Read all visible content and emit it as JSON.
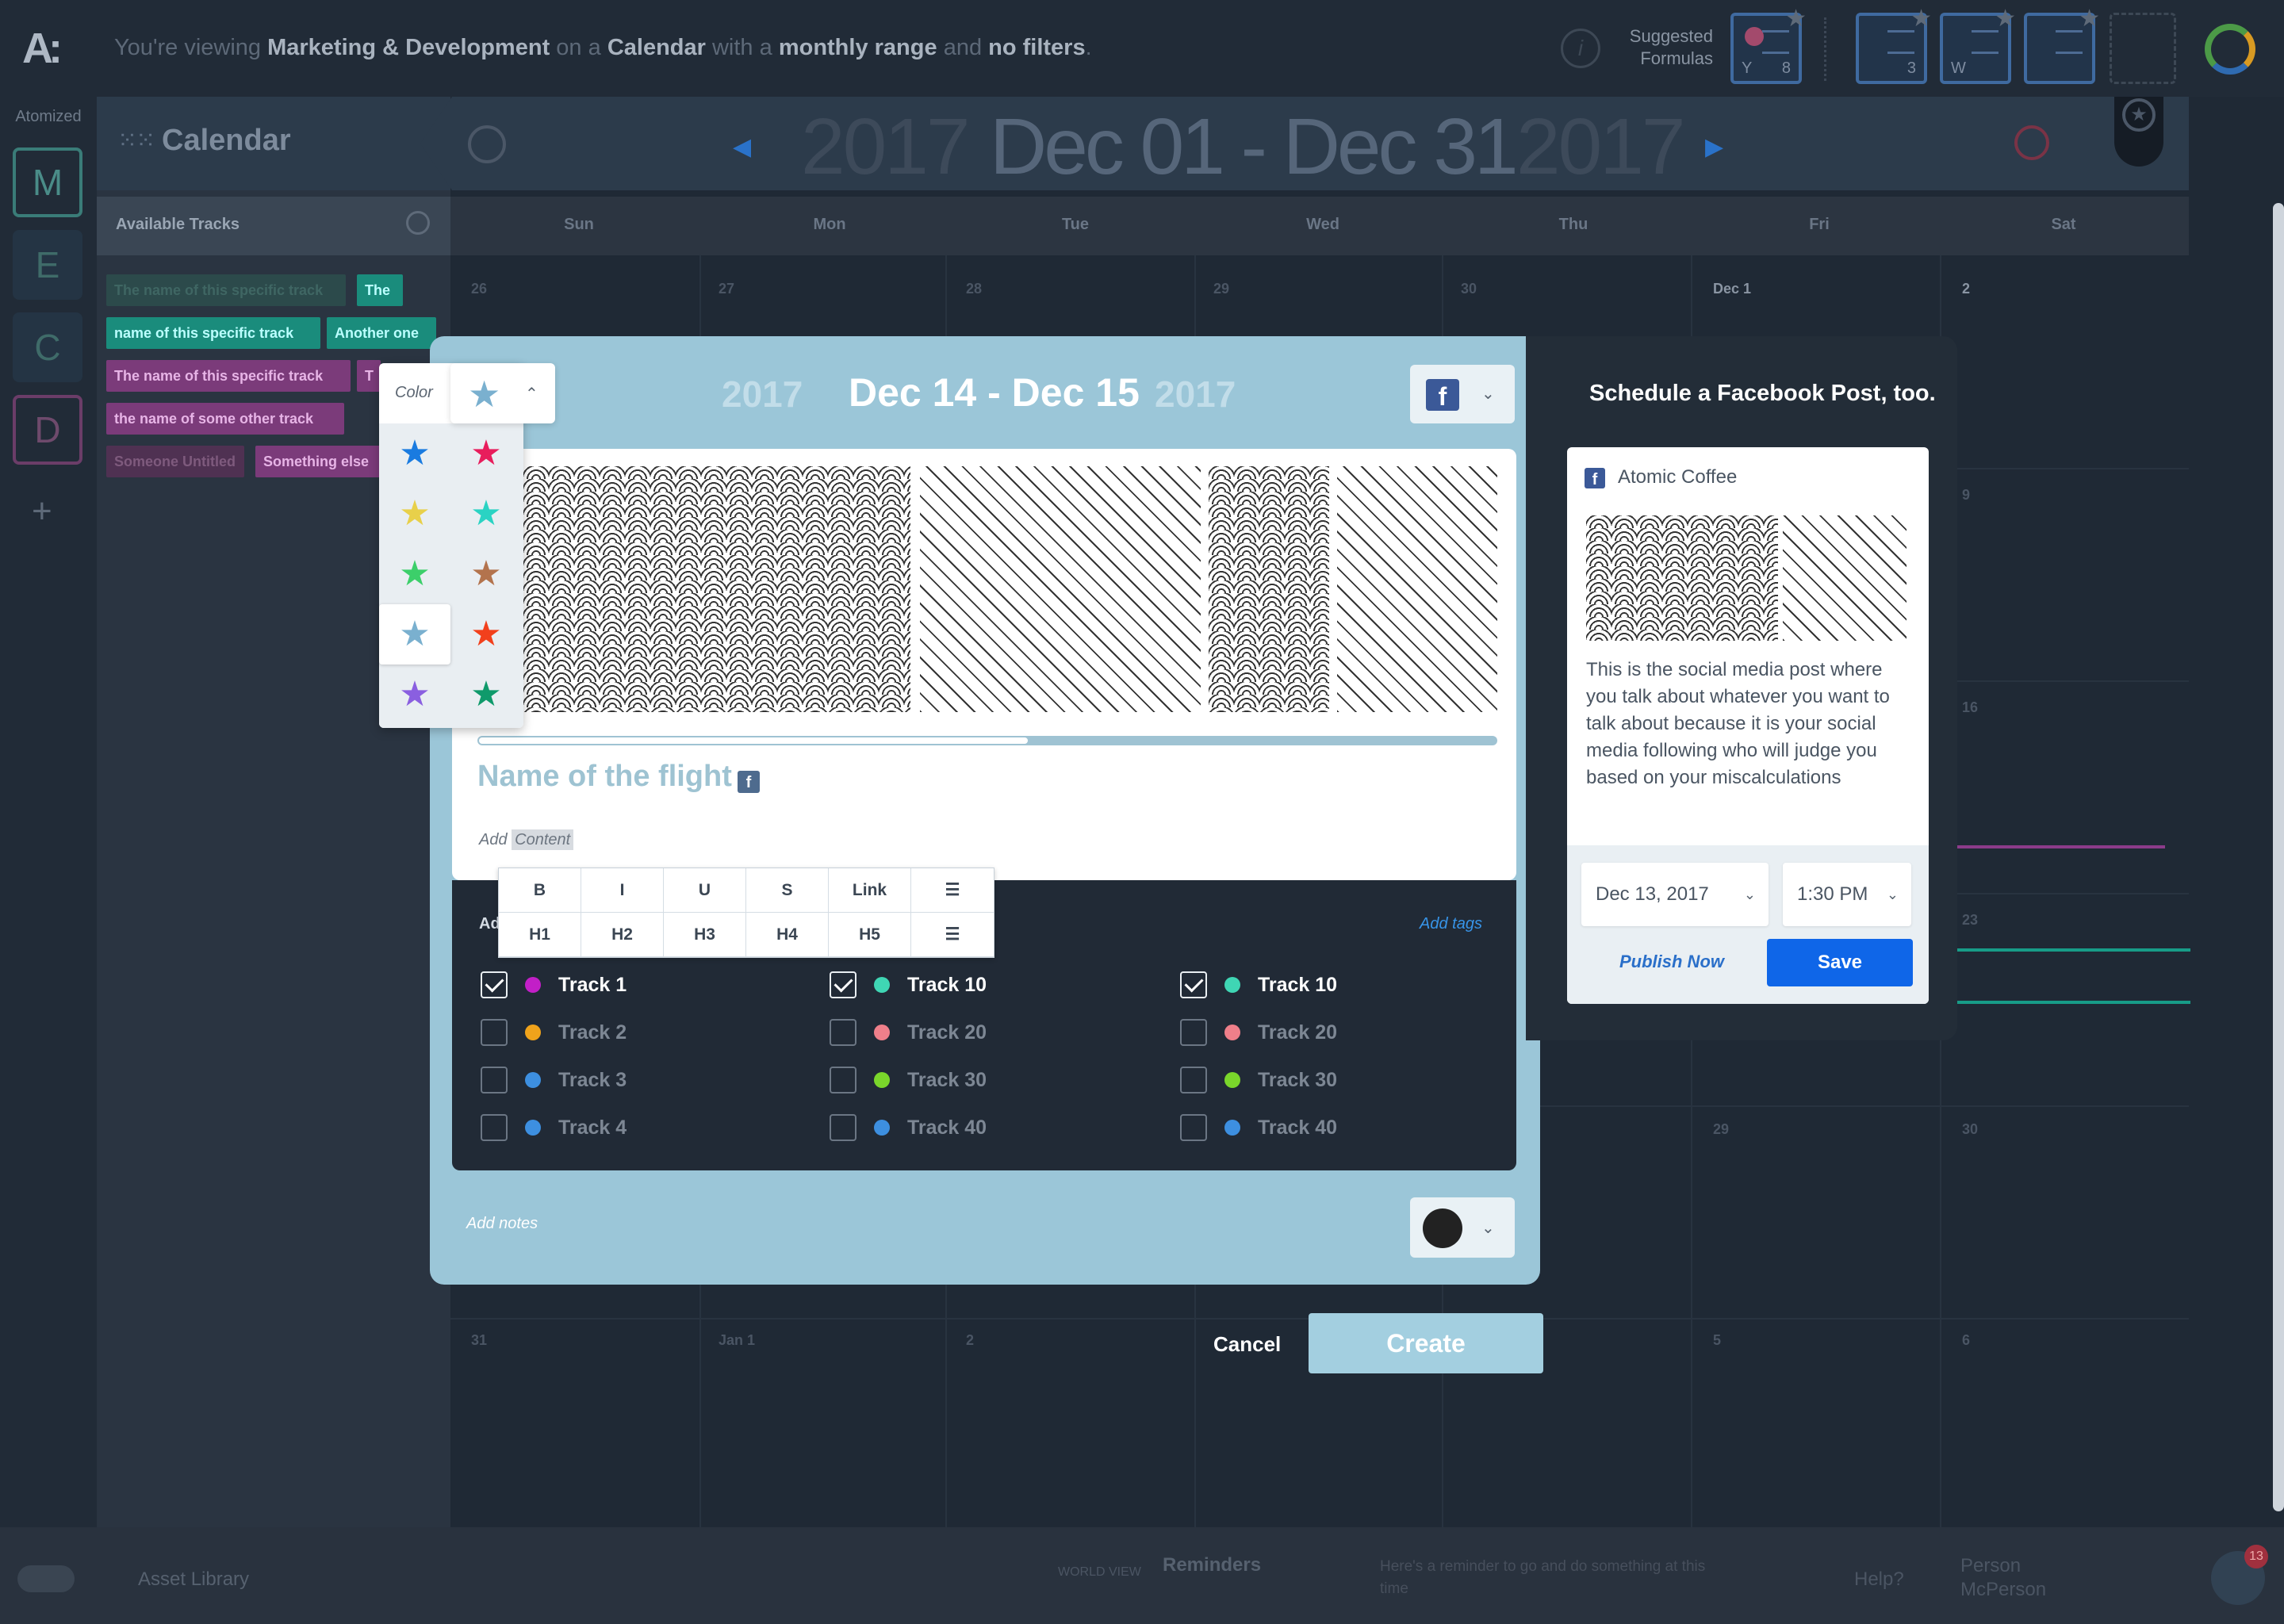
{
  "header": {
    "prefix": "You're viewing",
    "team": "Marketing & Development",
    "on_a": "on a",
    "view": "Calendar",
    "with_a": "with a",
    "range": "monthly range",
    "and": "and",
    "filters": "no filters",
    "suffix": ".",
    "suggested": "Suggested Formulas",
    "formula_cards": [
      {
        "letter": "Y",
        "num": "8"
      },
      {
        "letter": "",
        "num": "3"
      },
      {
        "letter": "W",
        "num": ""
      },
      {
        "letter": "",
        "num": ""
      }
    ]
  },
  "rail": {
    "label": "Atomized",
    "tiles": [
      "M",
      "E",
      "C",
      "D"
    ],
    "add": "+"
  },
  "sidebar": {
    "title": "Calendar",
    "tracks_title": "Available Tracks",
    "chips": [
      "The name of this specific track",
      "The",
      "name of this specific track",
      "Another one",
      "The name of this specific track",
      "T",
      "the name of some other track",
      "Someone Untitled",
      "Something else"
    ]
  },
  "calendar": {
    "year_left": "2017",
    "range": "Dec 01 - Dec 31",
    "year_right": "2017",
    "days": [
      "Sun",
      "Mon",
      "Tue",
      "Wed",
      "Thu",
      "Fri",
      "Sat"
    ],
    "dates_row1": [
      "26",
      "27",
      "28",
      "29",
      "30",
      "Dec 1",
      "2"
    ],
    "side_dates": [
      "9",
      "16",
      "23"
    ],
    "row5": [
      "29",
      "30"
    ],
    "row6": [
      "31",
      "Jan 1",
      "2",
      "5",
      "6"
    ]
  },
  "modal": {
    "year_left": "2017",
    "range": "Dec 14 - Dec 15",
    "year_right": "2017",
    "flight_name": "Name of the flight",
    "add": "Add",
    "content": "Content",
    "format_buttons": [
      "B",
      "I",
      "U",
      "S",
      "Link",
      "",
      "H1",
      "H2",
      "H3",
      "H4",
      "H5",
      ""
    ],
    "ad_label": "Ad",
    "add_tags": "Add tags",
    "tracks_col1": [
      {
        "name": "Track 1",
        "checked": true,
        "color": "#c21fc7"
      },
      {
        "name": "Track 2",
        "checked": false,
        "color": "#f0a31b"
      },
      {
        "name": "Track 3",
        "checked": false,
        "color": "#3d8fe0"
      },
      {
        "name": "Track 4",
        "checked": false,
        "color": "#3d8fe0"
      }
    ],
    "tracks_col2": [
      {
        "name": "Track 10",
        "checked": true,
        "color": "#3fd6b4"
      },
      {
        "name": "Track 20",
        "checked": false,
        "color": "#ef7f8a"
      },
      {
        "name": "Track 30",
        "checked": false,
        "color": "#7ad62b"
      },
      {
        "name": "Track 40",
        "checked": false,
        "color": "#3d8fe0"
      }
    ],
    "tracks_col3": [
      {
        "name": "Track 10",
        "checked": true,
        "color": "#3fd6b4"
      },
      {
        "name": "Track 20",
        "checked": false,
        "color": "#ef7f8a"
      },
      {
        "name": "Track 30",
        "checked": false,
        "color": "#7ad62b"
      },
      {
        "name": "Track 40",
        "checked": false,
        "color": "#3d8fe0"
      }
    ],
    "add_notes": "Add notes",
    "cancel": "Cancel",
    "create": "Create",
    "progress_fraction": 0.54
  },
  "color_picker": {
    "label": "Color",
    "selected_color": "#7ab0cf",
    "stars": [
      {
        "color": "#1a7be0",
        "selected": false
      },
      {
        "color": "#e81d5c",
        "selected": false
      },
      {
        "color": "#e8d04a",
        "selected": false
      },
      {
        "color": "#2ad3c3",
        "selected": false
      },
      {
        "color": "#3ccf6a",
        "selected": false
      },
      {
        "color": "#b3734d",
        "selected": false
      },
      {
        "color": "#7ab0cf",
        "selected": true
      },
      {
        "color": "#f2401c",
        "selected": false
      },
      {
        "color": "#8a5fe0",
        "selected": false
      },
      {
        "color": "#0f9a6b",
        "selected": false
      }
    ]
  },
  "facebook": {
    "title": "Schedule a Facebook Post, too.",
    "page": "Atomic Coffee",
    "text": "This is the social media post where you talk about whatever you want to talk about because it is your social media following who will judge you based on your miscalculations",
    "date": "Dec 13, 2017",
    "time": "1:30 PM",
    "publish": "Publish Now",
    "save": "Save"
  },
  "bottom": {
    "asset_library": "Asset Library",
    "world_view": "WORLD VIEW",
    "reminders": "Reminders",
    "reminder_text": "Here's a reminder to go and do something at this time",
    "help": "Help?",
    "person": "Person McPerson",
    "badge": "13"
  }
}
